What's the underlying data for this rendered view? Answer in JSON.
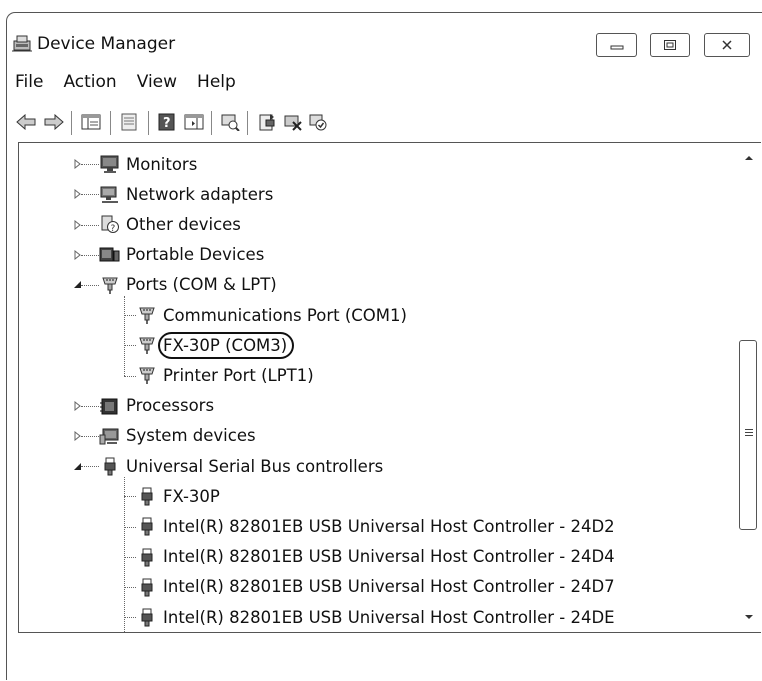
{
  "window": {
    "title": "Device Manager",
    "controls": {
      "minimize": "minimize",
      "maximize": "maximize",
      "close": "close"
    }
  },
  "menu": [
    "File",
    "Action",
    "View",
    "Help"
  ],
  "toolbar": {
    "buttons": [
      "back-arrow-icon",
      "forward-arrow-icon",
      "show-hide-console-tree-icon",
      "properties-icon",
      "help-icon",
      "show-hide-action-pane-icon",
      "scan-hardware-icon",
      "update-driver-icon",
      "uninstall-icon",
      "enable-device-icon"
    ]
  },
  "tree": [
    {
      "label": "Monitors",
      "icon": "monitor-icon",
      "level": 1,
      "expander": "collapsed"
    },
    {
      "label": "Network adapters",
      "icon": "network-adapter-icon",
      "level": 1,
      "expander": "collapsed"
    },
    {
      "label": "Other devices",
      "icon": "unknown-device-icon",
      "level": 1,
      "expander": "collapsed"
    },
    {
      "label": "Portable Devices",
      "icon": "portable-device-icon",
      "level": 1,
      "expander": "collapsed"
    },
    {
      "label": "Ports (COM & LPT)",
      "icon": "port-icon",
      "level": 1,
      "expander": "expanded"
    },
    {
      "label": "Communications Port (COM1)",
      "icon": "port-icon",
      "level": 2
    },
    {
      "label": "FX-30P (COM3)",
      "icon": "port-icon",
      "level": 2,
      "highlighted": true
    },
    {
      "label": "Printer Port (LPT1)",
      "icon": "port-icon",
      "level": 2
    },
    {
      "label": "Processors",
      "icon": "processor-icon",
      "level": 1,
      "expander": "collapsed"
    },
    {
      "label": "System devices",
      "icon": "system-device-icon",
      "level": 1,
      "expander": "collapsed"
    },
    {
      "label": "Universal Serial Bus controllers",
      "icon": "usb-icon",
      "level": 1,
      "expander": "expanded"
    },
    {
      "label": "FX-30P",
      "icon": "usb-icon",
      "level": 2
    },
    {
      "label": "Intel(R) 82801EB USB Universal Host Controller - 24D2",
      "icon": "usb-icon",
      "level": 2
    },
    {
      "label": "Intel(R) 82801EB USB Universal Host Controller - 24D4",
      "icon": "usb-icon",
      "level": 2
    },
    {
      "label": "Intel(R) 82801EB USB Universal Host Controller - 24D7",
      "icon": "usb-icon",
      "level": 2
    },
    {
      "label": "Intel(R) 82801EB USB Universal Host Controller - 24DE",
      "icon": "usb-icon",
      "level": 2
    }
  ],
  "colors": {
    "border": "#555555",
    "text": "#111111"
  }
}
